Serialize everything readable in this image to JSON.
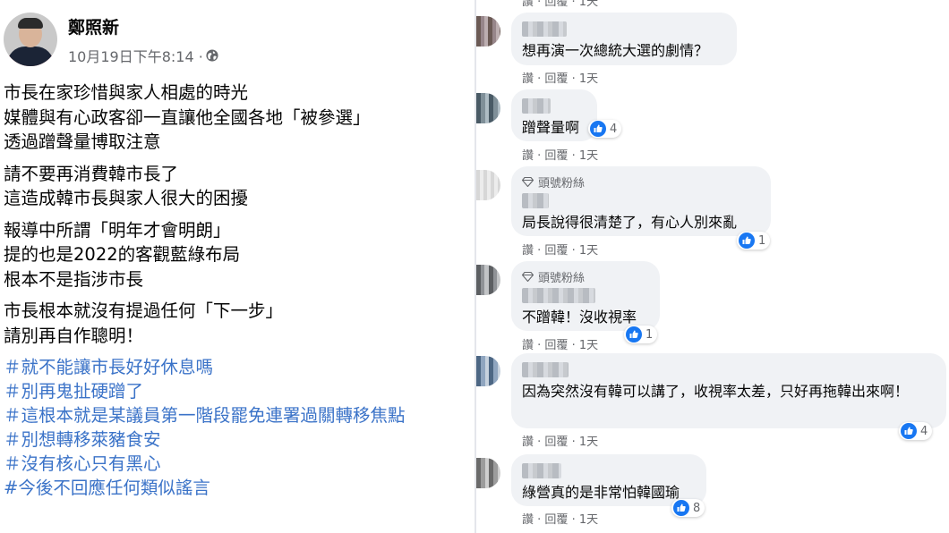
{
  "post": {
    "author": "鄭照新",
    "time": "10月19日下午8:14 · ",
    "globe_icon": "globe-icon",
    "paragraphs": [
      [
        "市長在家珍惜與家人相處的時光",
        "媒體與有心政客卻一直讓他全國各地「被參選」",
        "透過蹭聲量博取注意"
      ],
      [
        "請不要再消費韓市長了",
        "這造成韓市長與家人很大的困擾"
      ],
      [
        "報導中所謂「明年才會明朗」",
        "提的也是2022的客觀藍綠布局",
        "根本不是指涉市長"
      ],
      [
        "市長根本就沒有提過任何「下一步」",
        "請別再自作聰明！"
      ]
    ],
    "hashtags": [
      "＃就不能讓市長好好休息嗎",
      "＃別再鬼扯硬蹭了",
      "＃這根本就是某議員第一階段罷免連署過關轉移焦點",
      "＃別想轉移萊豬食安",
      "＃沒有核心只有黑心",
      "#今後不回應任何類似謠言"
    ]
  },
  "comments": {
    "top_partial_actions": "讚 · 回覆 · 1天",
    "badge_label": "頭號粉絲",
    "like_label": "讚",
    "reply_label": "回覆",
    "sep": " · ",
    "items": [
      {
        "text": "想再演一次總統大選的劇情？",
        "time": "1天",
        "likes": "",
        "badge": false
      },
      {
        "text": "蹭聲量啊",
        "time": "1天",
        "likes": "4",
        "badge": false
      },
      {
        "text": "局長說得很清楚了，有心人別來亂",
        "time": "1天",
        "likes": "1",
        "badge": true
      },
      {
        "text": "不蹭韓！沒收視率",
        "time": "1天",
        "likes": "1",
        "badge": true
      },
      {
        "text": "因為突然沒有韓可以講了，收視率太差，只好再拖韓出來啊！",
        "time": "1天",
        "likes": "4",
        "badge": false
      },
      {
        "text": "綠營真的是非常怕韓國瑜",
        "time": "1天",
        "likes": "8",
        "badge": false
      }
    ]
  },
  "colors": {
    "link_blue": "#3b73c8",
    "meta_gray": "#65676b",
    "bubble_bg": "#f0f2f5",
    "like_blue": "#1877f2"
  }
}
